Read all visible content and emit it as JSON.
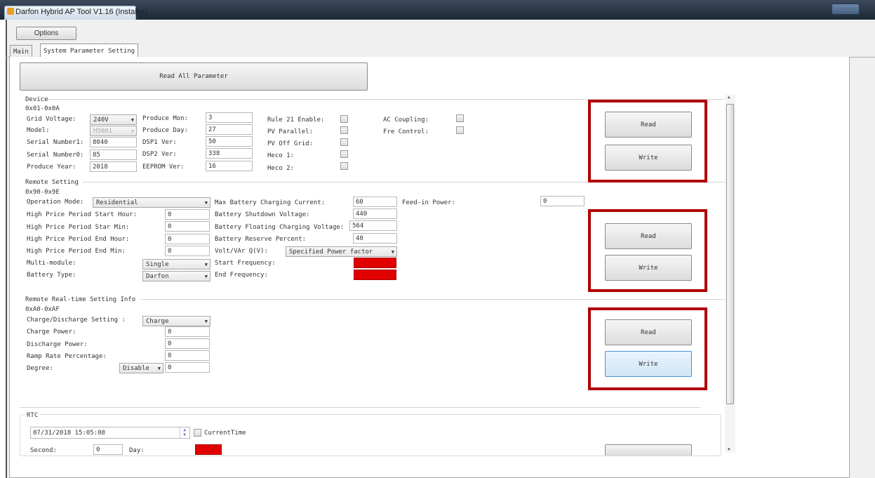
{
  "window": {
    "title": "Darfon Hybrid AP Tool V1.16 (Installer)"
  },
  "toolbar": {
    "options_label": "Options"
  },
  "tabs": [
    {
      "label": "Main"
    },
    {
      "label": "System Parameter Setting"
    }
  ],
  "read_all_label": "Read All Parameter",
  "device": {
    "title": "Device",
    "range": "0x01-0x0A",
    "grid_voltage_label": "Grid Voltage:",
    "grid_voltage_value": "240V",
    "model_label": "Model:",
    "model_value": "H5001",
    "serial1_label": "Serial Number1:",
    "serial1_value": "8040",
    "serial0_label": "Serial Number0:",
    "serial0_value": "85",
    "produce_year_label": "Produce Year:",
    "produce_year_value": "2018",
    "produce_mon_label": "Produce Mon:",
    "produce_mon_value": "3",
    "produce_day_label": "Produce Day:",
    "produce_day_value": "27",
    "dsp1_label": "DSP1 Ver:",
    "dsp1_value": "50",
    "dsp2_label": "DSP2 Ver:",
    "dsp2_value": "338",
    "eeprom_label": "EEPROM Ver:",
    "eeprom_value": "16",
    "rule21_label": "Rule 21 Enable:",
    "pv_parallel_label": "PV Parallel:",
    "pv_off_grid_label": "PV Off Grid:",
    "heco1_label": "Heco 1:",
    "heco2_label": "Heco 2:",
    "ac_coupling_label": "AC Coupling:",
    "fre_control_label": "Fre Control:"
  },
  "remote": {
    "title": "Remote Setting",
    "range": "0x90-0x9E",
    "op_mode_label": "Operation Mode:",
    "op_mode_value": "Residential",
    "hp_start_hour_label": "High Price Period Start Hour:",
    "hp_start_hour_value": "0",
    "hp_star_min_label": "High Price Period Star Min:",
    "hp_star_min_value": "0",
    "hp_end_hour_label": "High Price Period End Hour:",
    "hp_end_hour_value": "0",
    "hp_end_min_label": "High Price Period End Min:",
    "hp_end_min_value": "0",
    "multi_module_label": "Multi-module:",
    "multi_module_value": "Single",
    "battery_type_label": "Battery Type:",
    "battery_type_value": "Darfon",
    "max_charge_label": "Max Battery Charging Current:",
    "max_charge_value": "60",
    "shutdown_label": "Battery Shutdown Voltage:",
    "shutdown_value": "440",
    "floating_label": "Battery Floating Charging Voltage:",
    "floating_value": "564",
    "reserve_label": "Battery Reserve Percent:",
    "reserve_value": "40",
    "voltvar_label": "Volt/VAr Q(V):",
    "voltvar_value": "Specified Power factor",
    "start_freq_label": "Start Frequency:",
    "end_freq_label": "End Frequency:",
    "feed_in_label": "Feed-in Power:",
    "feed_in_value": "0"
  },
  "realtime": {
    "title": "Remote Real-time Setting Info",
    "range": "0xA0-0xAF",
    "cd_setting_label": "Charge/Discharge Setting :",
    "cd_setting_value": "Charge",
    "charge_power_label": "Charge Power:",
    "charge_power_value": "0",
    "discharge_power_label": "Discharge Power:",
    "discharge_power_value": "0",
    "ramp_rate_label": "Ramp Rate Percentage:",
    "ramp_rate_value": "0",
    "degree_label": "Degree:",
    "degree_select": "Disable",
    "degree_value": "0"
  },
  "rtc": {
    "title": "RTC",
    "datetime_value": "07/31/2018 15:05:08",
    "current_time_label": "CurrentTime",
    "second_label": "Second:",
    "second_value": "0",
    "day_label": "Day:"
  },
  "buttons": {
    "read": "Read",
    "write": "Write"
  },
  "colors": {
    "highlight_frame": "#b00000",
    "error_field": "#e00000"
  }
}
